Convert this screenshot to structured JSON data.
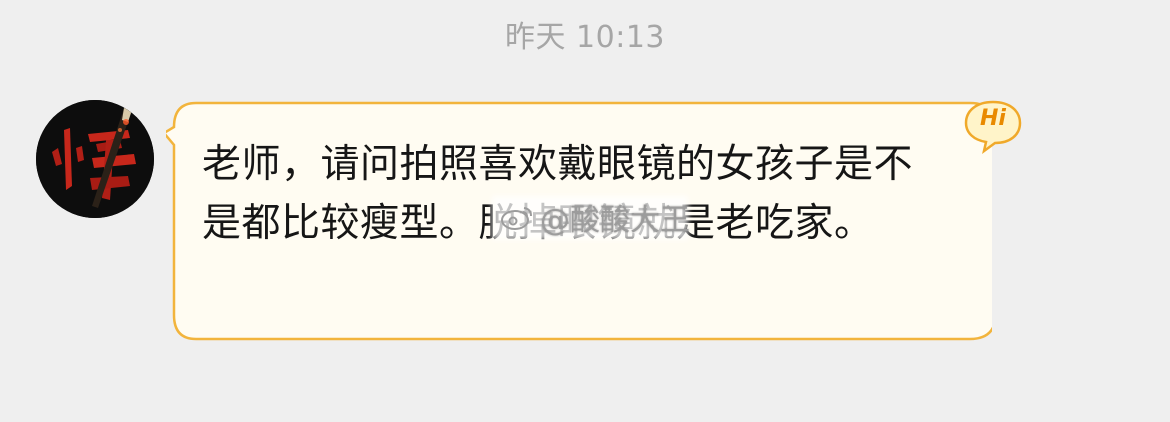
{
  "chat": {
    "timestamp": "昨天 10:13",
    "message": {
      "text": "老师，请问拍照喜欢戴眼镜的女孩子是不是都比较瘦型。脱掉眼镜就是老吃家。",
      "badge": "Hi"
    },
    "watermark": "@酸酸大王"
  },
  "colors": {
    "background": "#efefef",
    "bubble_fill": "#fffcf2",
    "bubble_border": "#f2b43c",
    "badge_text": "#e98a00",
    "avatar_glyph": "#c7271b"
  },
  "icons": {
    "avatar": "calligraphy-avatar-icon",
    "badge": "hi-badge-icon",
    "watermark": "weibo-icon"
  }
}
